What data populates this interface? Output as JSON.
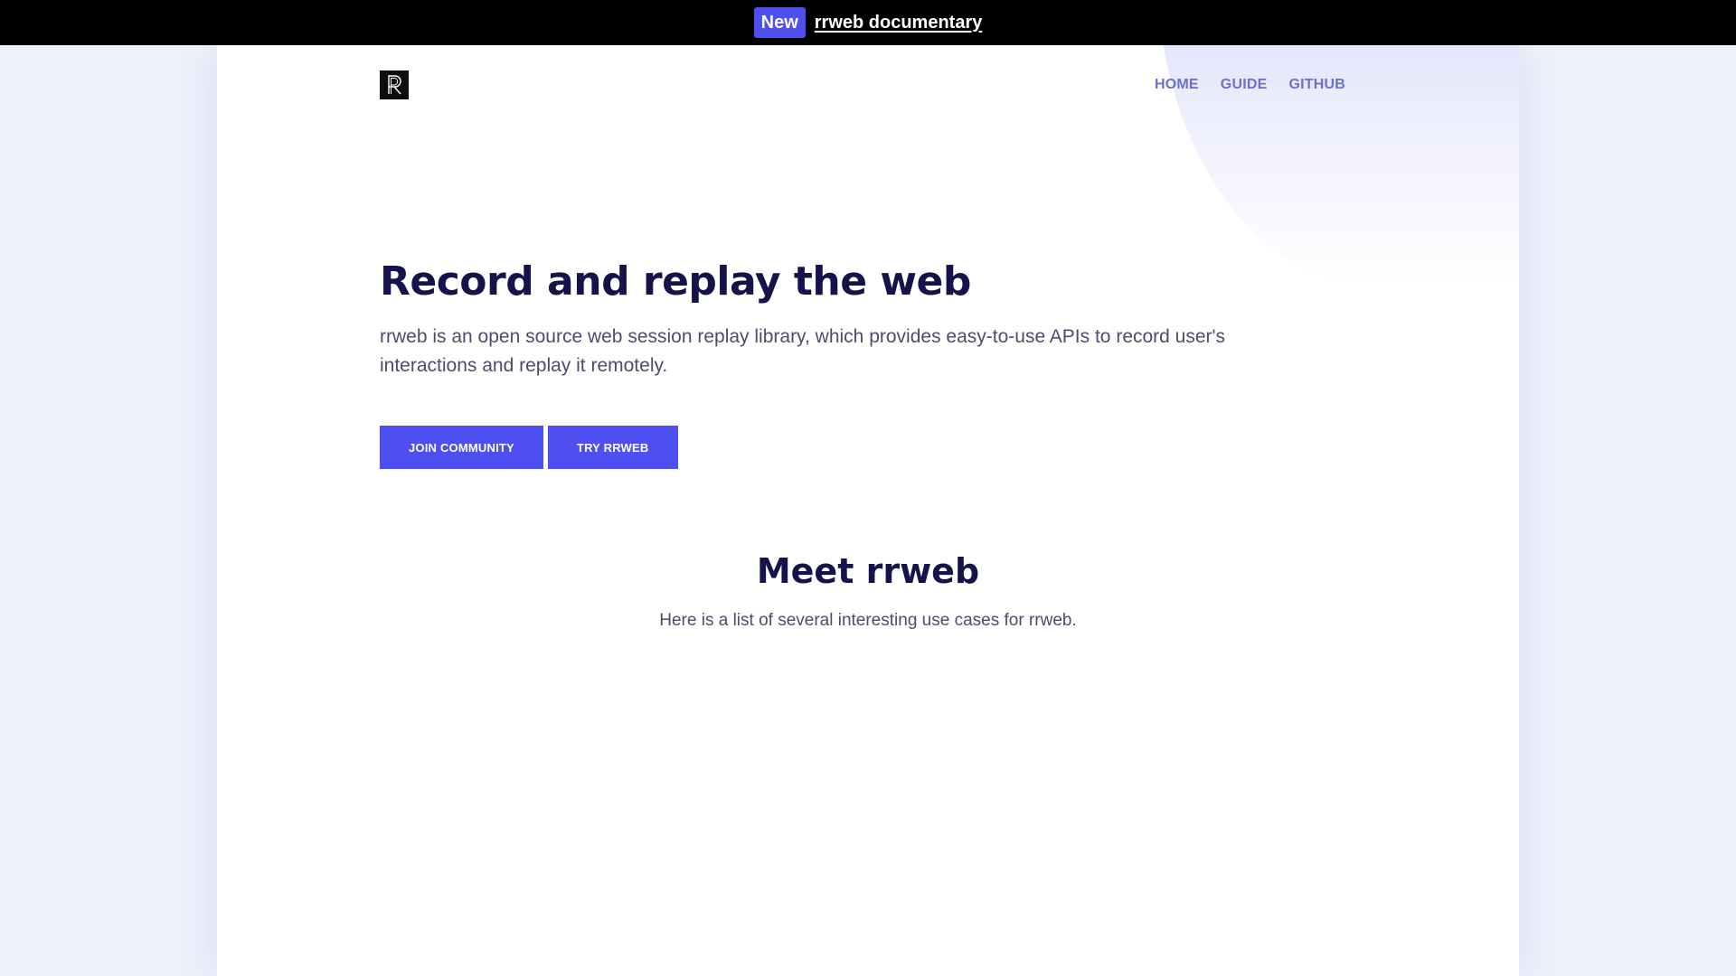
{
  "announcement": {
    "badge": "New",
    "link_text": "rrweb documentary"
  },
  "header": {
    "logo_icon": "rrweb-logo-icon",
    "nav": [
      {
        "label": "HOME"
      },
      {
        "label": "GUIDE"
      },
      {
        "label": "GITHUB"
      }
    ]
  },
  "hero": {
    "title": "Record and replay the web",
    "description": "rrweb is an open source web session replay library, which provides easy-to-use APIs to record user's interactions and replay it remotely.",
    "buttons": [
      {
        "label": "JOIN COMMUNITY"
      },
      {
        "label": "TRY RRWEB"
      }
    ]
  },
  "meet": {
    "title": "Meet rrweb",
    "description": "Here is a list of several interesting use cases for rrweb."
  },
  "colors": {
    "accent": "#4e4ff0",
    "heading": "#15134a",
    "nav": "#6b6fd1",
    "text": "#4b4d6b",
    "background": "#eef1fb"
  }
}
